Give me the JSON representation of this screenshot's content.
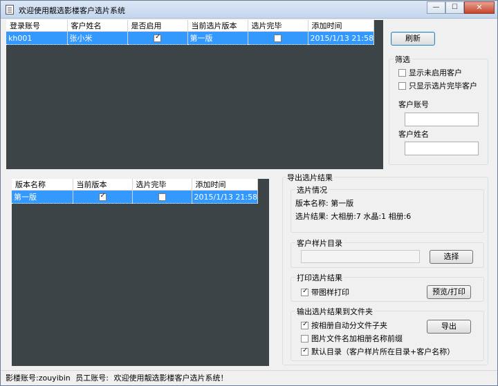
{
  "window": {
    "title": "欢迎使用靓选影楼客户选片系统",
    "controls": {
      "minimize": "—",
      "maximize": "☐",
      "close": "✕"
    }
  },
  "customer_grid": {
    "columns": [
      "登录账号",
      "客户姓名",
      "是否启用",
      "当前选片版本",
      "选片完毕",
      "添加时间"
    ],
    "rows": [
      {
        "account": "kh001",
        "name": "张小米",
        "enabled": true,
        "version": "第一版",
        "finished": false,
        "added": "2015/1/13 21:58"
      }
    ]
  },
  "version_grid": {
    "columns": [
      "版本名称",
      "当前版本",
      "选片完毕",
      "添加时间"
    ],
    "rows": [
      {
        "name": "第一版",
        "current": true,
        "finished": false,
        "added": "2015/1/13 21:58"
      }
    ]
  },
  "refresh_button": "刷新",
  "filter": {
    "title": "筛选",
    "show_disabled": {
      "label": "显示未启用客户",
      "checked": false
    },
    "show_finished": {
      "label": "只显示选片完毕客户",
      "checked": false
    },
    "account_label": "客户账号",
    "account_value": "",
    "name_label": "客户姓名",
    "name_value": ""
  },
  "export": {
    "title": "导出选片结果",
    "info": {
      "title": "选片情况",
      "version_line": "版本名称: 第一版",
      "result_line": "选片结果:  大相册:7 水晶:1 相册:6"
    },
    "sample_dir": {
      "title": "客户样片目录",
      "value": "",
      "button": "选择"
    },
    "print": {
      "title": "打印选片结果",
      "with_samples": {
        "label": "带图样打印",
        "checked": true
      },
      "button": "预览/打印"
    },
    "to_folder": {
      "title": "输出选片结果到文件夹",
      "auto_subfolder": {
        "label": "按相册自动分文件子夹",
        "checked": true
      },
      "prefix_album": {
        "label": "图片文件名加相册名称前缀",
        "checked": false
      },
      "default_dir": {
        "label": "默认目录（客户样片所在目录+客户名称）",
        "checked": true
      },
      "button": "导出"
    }
  },
  "status": {
    "studio_account": "影楼账号:zouyibin",
    "staff_account": "员工账号:",
    "message": "欢迎使用靓选影楼客户选片系统！"
  }
}
